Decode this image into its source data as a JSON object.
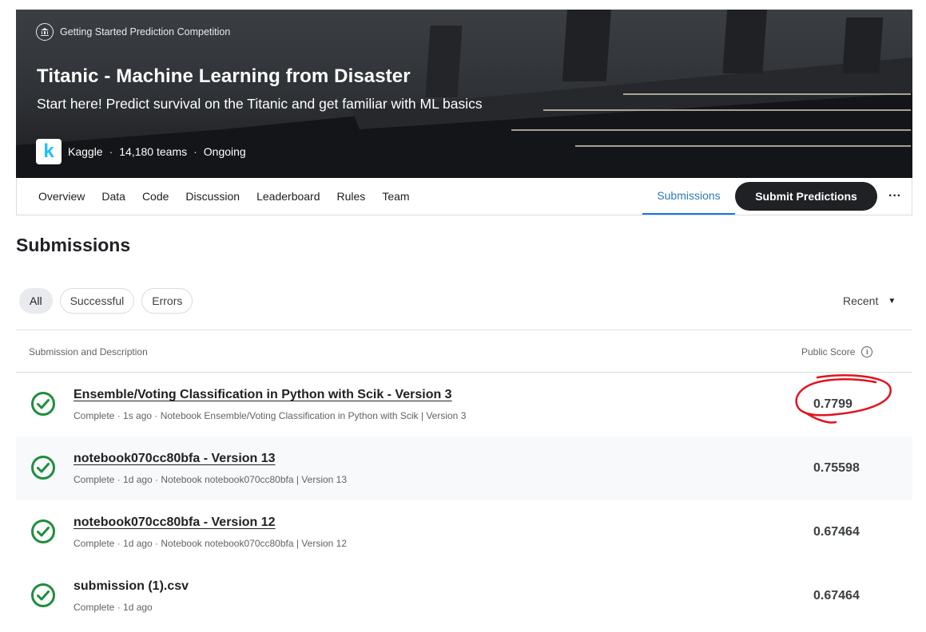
{
  "banner": {
    "competition_type": "Getting Started Prediction Competition",
    "title": "Titanic - Machine Learning from Disaster",
    "subtitle": "Start here! Predict survival on the Titanic and get familiar with ML basics",
    "host": "Kaggle",
    "logo_letter": "k",
    "teams": "14,180 teams",
    "status": "Ongoing",
    "separator": "·"
  },
  "nav": {
    "tabs": [
      "Overview",
      "Data",
      "Code",
      "Discussion",
      "Leaderboard",
      "Rules",
      "Team"
    ],
    "active_tab": "Submissions",
    "submit_label": "Submit Predictions",
    "more_label": "···"
  },
  "page": {
    "title": "Submissions"
  },
  "filters": {
    "chips": [
      "All",
      "Successful",
      "Errors"
    ],
    "sort_label": "Recent"
  },
  "table": {
    "headers": {
      "submission": "Submission and Description",
      "score": "Public Score"
    },
    "rows": [
      {
        "name": "Ensemble/Voting Classification in Python with Scik - Version 3",
        "meta": "Complete · 1s ago · Notebook Ensemble/Voting Classification in Python with Scik | Version 3",
        "score": "0.7799"
      },
      {
        "name": "notebook070cc80bfa - Version 13",
        "meta": "Complete · 1d ago · Notebook notebook070cc80bfa | Version 13",
        "score": "0.75598"
      },
      {
        "name": "notebook070cc80bfa - Version 12",
        "meta": "Complete · 1d ago · Notebook notebook070cc80bfa | Version 12",
        "score": "0.67464"
      },
      {
        "name": "submission (1).csv",
        "meta": "Complete · 1d ago",
        "score": "0.67464"
      }
    ]
  },
  "colors": {
    "accent": "#2c7ab8",
    "success": "#1e8e3e",
    "annotation": "#e0141e",
    "dark_button": "#202124"
  }
}
